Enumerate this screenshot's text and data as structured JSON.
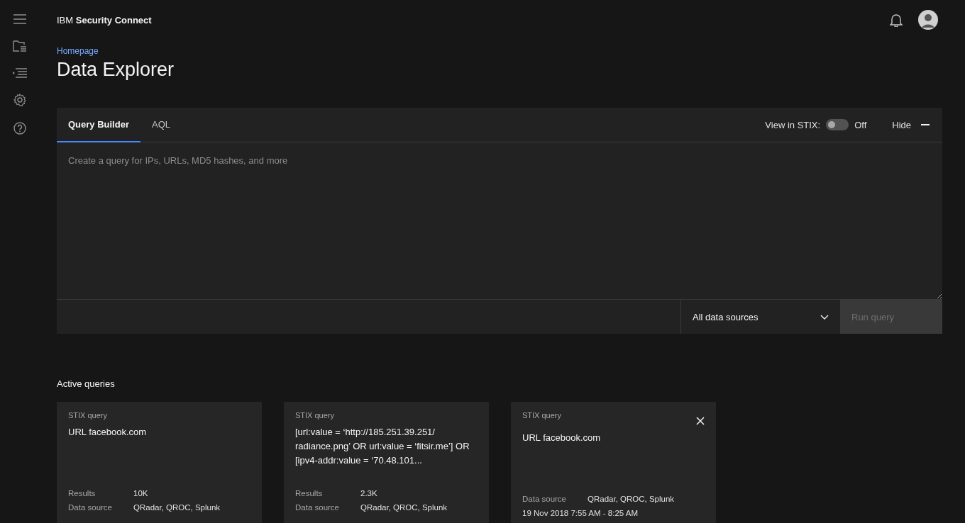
{
  "header": {
    "brand_prefix": "IBM",
    "brand_name": "Security Connect"
  },
  "breadcrumb": "Homepage",
  "title": "Data Explorer",
  "query_panel": {
    "tabs": [
      {
        "label": "Query Builder",
        "selected": true
      },
      {
        "label": "AQL",
        "selected": false
      }
    ],
    "stix_toggle": {
      "label": "View in STIX:",
      "on": false,
      "state_text": "Off"
    },
    "hide_label": "Hide",
    "placeholder": "Create a query for IPs, URLs, MD5 hashes, and more",
    "source_select": "All data sources",
    "run_button": {
      "label": "Run query",
      "disabled": true
    }
  },
  "active_queries": {
    "heading": "Active queries",
    "cards": [
      {
        "type": "STIX query",
        "query": "URL facebook.com",
        "closable": false,
        "rows": [
          {
            "label": "Results",
            "value": "10K"
          },
          {
            "label": "Data source",
            "value": "QRadar, QROC, Splunk"
          }
        ]
      },
      {
        "type": "STIX query",
        "query": "[url:value = ‘http://185.251.39.251/ radiance.png’ OR url:value = ‘fitsir.me’] OR [ipv4-addr:value = ‘70.48.101...",
        "closable": false,
        "rows": [
          {
            "label": "Results",
            "value": "2.3K"
          },
          {
            "label": "Data source",
            "value": "QRadar, QROC, Splunk"
          }
        ]
      },
      {
        "type": "STIX query",
        "query": "URL facebook.com",
        "closable": true,
        "rows": [
          {
            "label": "Data source",
            "value": "QRadar, QROC, Splunk"
          }
        ],
        "timestamp": "19 Nov 2018 7:55 AM - 8:25 AM"
      }
    ]
  }
}
